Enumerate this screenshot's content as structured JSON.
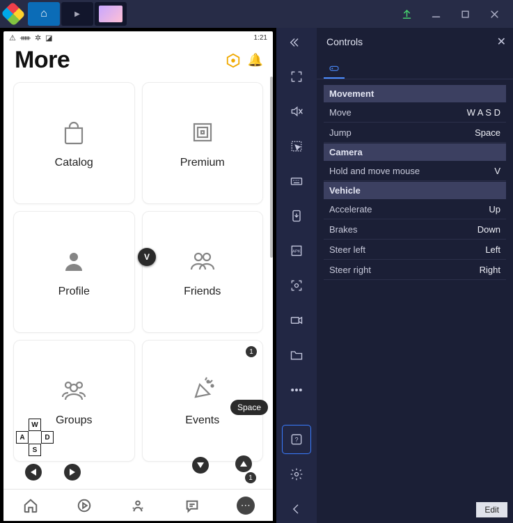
{
  "titlebar": {
    "tabs": [
      "home",
      "play-store",
      "game"
    ]
  },
  "status": {
    "time": "1:21"
  },
  "header": {
    "title": "More"
  },
  "cards": [
    {
      "label": "Catalog"
    },
    {
      "label": "Premium"
    },
    {
      "label": "Profile"
    },
    {
      "label": "Friends"
    },
    {
      "label": "Groups"
    },
    {
      "label": "Events",
      "badge": "1"
    }
  ],
  "overlay": {
    "vkey": "V",
    "spacekey": "Space",
    "dpad": {
      "up": "W",
      "left": "A",
      "down": "S",
      "right": "D"
    },
    "extra_badge": "1"
  },
  "panel": {
    "title": "Controls",
    "sections": [
      {
        "name": "Movement",
        "rows": [
          {
            "k": "Move",
            "v": "W A S D"
          },
          {
            "k": "Jump",
            "v": "Space"
          }
        ]
      },
      {
        "name": "Camera",
        "rows": [
          {
            "k": "Hold and move mouse",
            "v": "V"
          }
        ]
      },
      {
        "name": "Vehicle",
        "rows": [
          {
            "k": "Accelerate",
            "v": "Up"
          },
          {
            "k": "Brakes",
            "v": "Down"
          },
          {
            "k": "Steer left",
            "v": "Left"
          },
          {
            "k": "Steer right",
            "v": "Right"
          }
        ]
      }
    ],
    "edit": "Edit"
  }
}
